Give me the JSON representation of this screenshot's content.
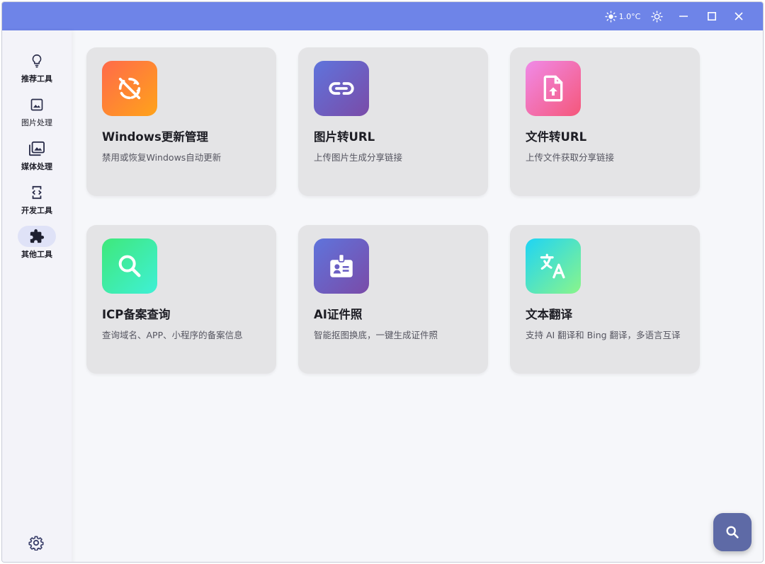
{
  "titlebar": {
    "weather_temp": "1.0°C",
    "icons": [
      "sun-icon",
      "brightness-icon",
      "minimize-icon",
      "maximize-icon",
      "close-icon"
    ]
  },
  "sidebar": {
    "items": [
      {
        "label": "推荐工具",
        "icon": "lightbulb-icon",
        "active": false
      },
      {
        "label": "图片处理",
        "icon": "image-icon",
        "active": false
      },
      {
        "label": "媒体处理",
        "icon": "photo-library-icon",
        "active": false
      },
      {
        "label": "开发工具",
        "icon": "developer-mode-icon",
        "active": false
      },
      {
        "label": "其他工具",
        "icon": "extension-icon",
        "active": true
      }
    ],
    "settings_icon": "gear-icon"
  },
  "tools": [
    {
      "title": "Windows更新管理",
      "desc": "禁用或恢复Windows自动更新",
      "icon": "sync-disabled-icon",
      "gradient": [
        "#ff6a4a",
        "#ffa31a"
      ]
    },
    {
      "title": "图片转URL",
      "desc": "上传图片生成分享链接",
      "icon": "link-icon",
      "gradient": [
        "#5f74dc",
        "#7a4ba8"
      ]
    },
    {
      "title": "文件转URL",
      "desc": "上传文件获取分享链接",
      "icon": "file-upload-icon",
      "gradient": [
        "#f08ae8",
        "#f5577a"
      ]
    },
    {
      "title": "ICP备案查询",
      "desc": "查询域名、APP、小程序的备案信息",
      "icon": "search-icon",
      "gradient": [
        "#3fe87a",
        "#3ff0d6"
      ]
    },
    {
      "title": "AI证件照",
      "desc": "智能抠图换底，一键生成证件照",
      "icon": "id-badge-icon",
      "gradient": [
        "#5f74dc",
        "#7a4ba8"
      ]
    },
    {
      "title": "文本翻译",
      "desc": "支持 AI 翻译和 Bing 翻译，多语言互译",
      "icon": "translate-icon",
      "gradient": [
        "#1ed4f5",
        "#8af58a"
      ]
    }
  ],
  "fab": {
    "icon": "search-icon"
  },
  "colors": {
    "titlebar": "#6e84e8",
    "fab": "#5e6aa6",
    "card": "#e4e4e6"
  }
}
